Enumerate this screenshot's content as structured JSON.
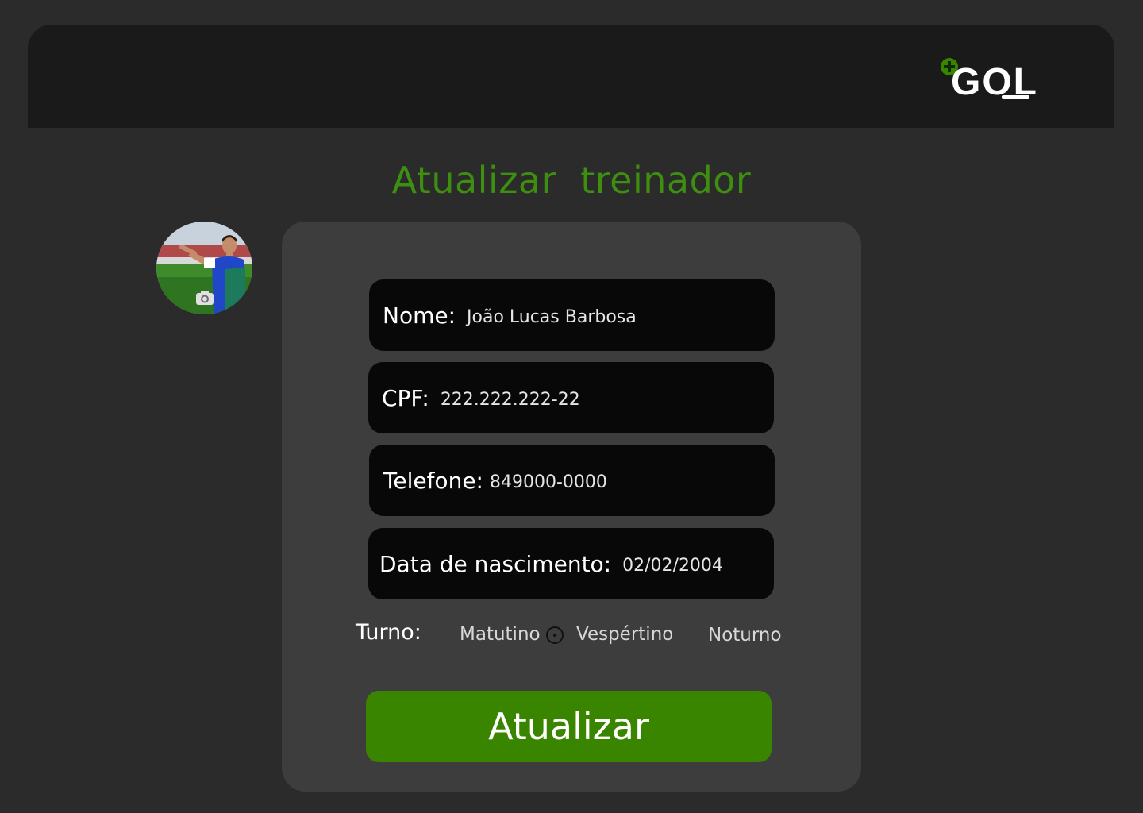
{
  "header": {
    "logo_text": "GOL",
    "logo_mark": "plus-icon"
  },
  "page": {
    "title": "Atualizar  treinador"
  },
  "avatar": {
    "icon": "camera-icon"
  },
  "form": {
    "nome": {
      "label": "Nome:",
      "value": "João Lucas Barbosa"
    },
    "cpf": {
      "label": "CPF:",
      "value": "222.222.222-22"
    },
    "telefone": {
      "label": "Telefone:",
      "value": "849000-0000"
    },
    "nascimento": {
      "label": "Data de nascimento:",
      "value": "02/02/2004"
    },
    "turno": {
      "label": "Turno:",
      "options": [
        "Matutino",
        "Vespértino",
        "Noturno"
      ]
    },
    "submit_label": "Atualizar"
  },
  "colors": {
    "accent": "#3a8500",
    "title": "#3e8e10",
    "background": "#2b2b2b",
    "panel": "#3d3d3d",
    "field": "#080808"
  }
}
